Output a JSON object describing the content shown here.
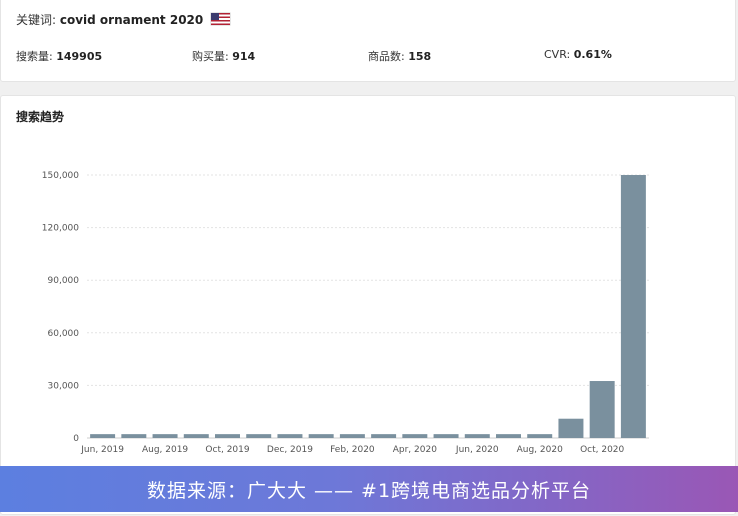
{
  "summary": {
    "keyword_label": "关键词:",
    "keyword_value": "covid ornament 2020",
    "metrics": [
      {
        "label": "搜索量:",
        "value": "149905"
      },
      {
        "label": "购买量:",
        "value": "914"
      },
      {
        "label": "商品数:",
        "value": "158"
      },
      {
        "label": "CVR:",
        "value": "0.61%"
      }
    ]
  },
  "trend": {
    "title": "搜索趋势"
  },
  "chart_data": {
    "type": "bar",
    "categories": [
      "Jun, 2019",
      "Jul, 2019",
      "Aug, 2019",
      "Sep, 2019",
      "Oct, 2019",
      "Nov, 2019",
      "Dec, 2019",
      "Jan, 2020",
      "Feb, 2020",
      "Mar, 2020",
      "Apr, 2020",
      "May, 2020",
      "Jun, 2020",
      "Jul, 2020",
      "Aug, 2020",
      "Sep, 2020",
      "Oct, 2020",
      "Nov, 2020"
    ],
    "values": [
      2200,
      2200,
      2200,
      2200,
      2200,
      2200,
      2200,
      2200,
      2200,
      2200,
      2200,
      2200,
      2200,
      2200,
      2200,
      11000,
      32500,
      150000
    ],
    "visible_x_labels": [
      "Jun, 2019",
      "Aug, 2019",
      "Oct, 2019",
      "Dec, 2019",
      "Feb, 2020",
      "Apr, 2020",
      "Jun, 2020",
      "Aug, 2020",
      "Oct, 2020"
    ],
    "y_ticks": [
      "0",
      "30,000",
      "60,000",
      "90,000",
      "120,000",
      "150,000"
    ],
    "ylim": [
      0,
      150000
    ],
    "bar_color": "#7a909e",
    "grid": true,
    "title": "",
    "xlabel": "",
    "ylabel": ""
  },
  "banner": {
    "text": "数据来源：广大大 —— #1跨境电商选品分析平台"
  }
}
